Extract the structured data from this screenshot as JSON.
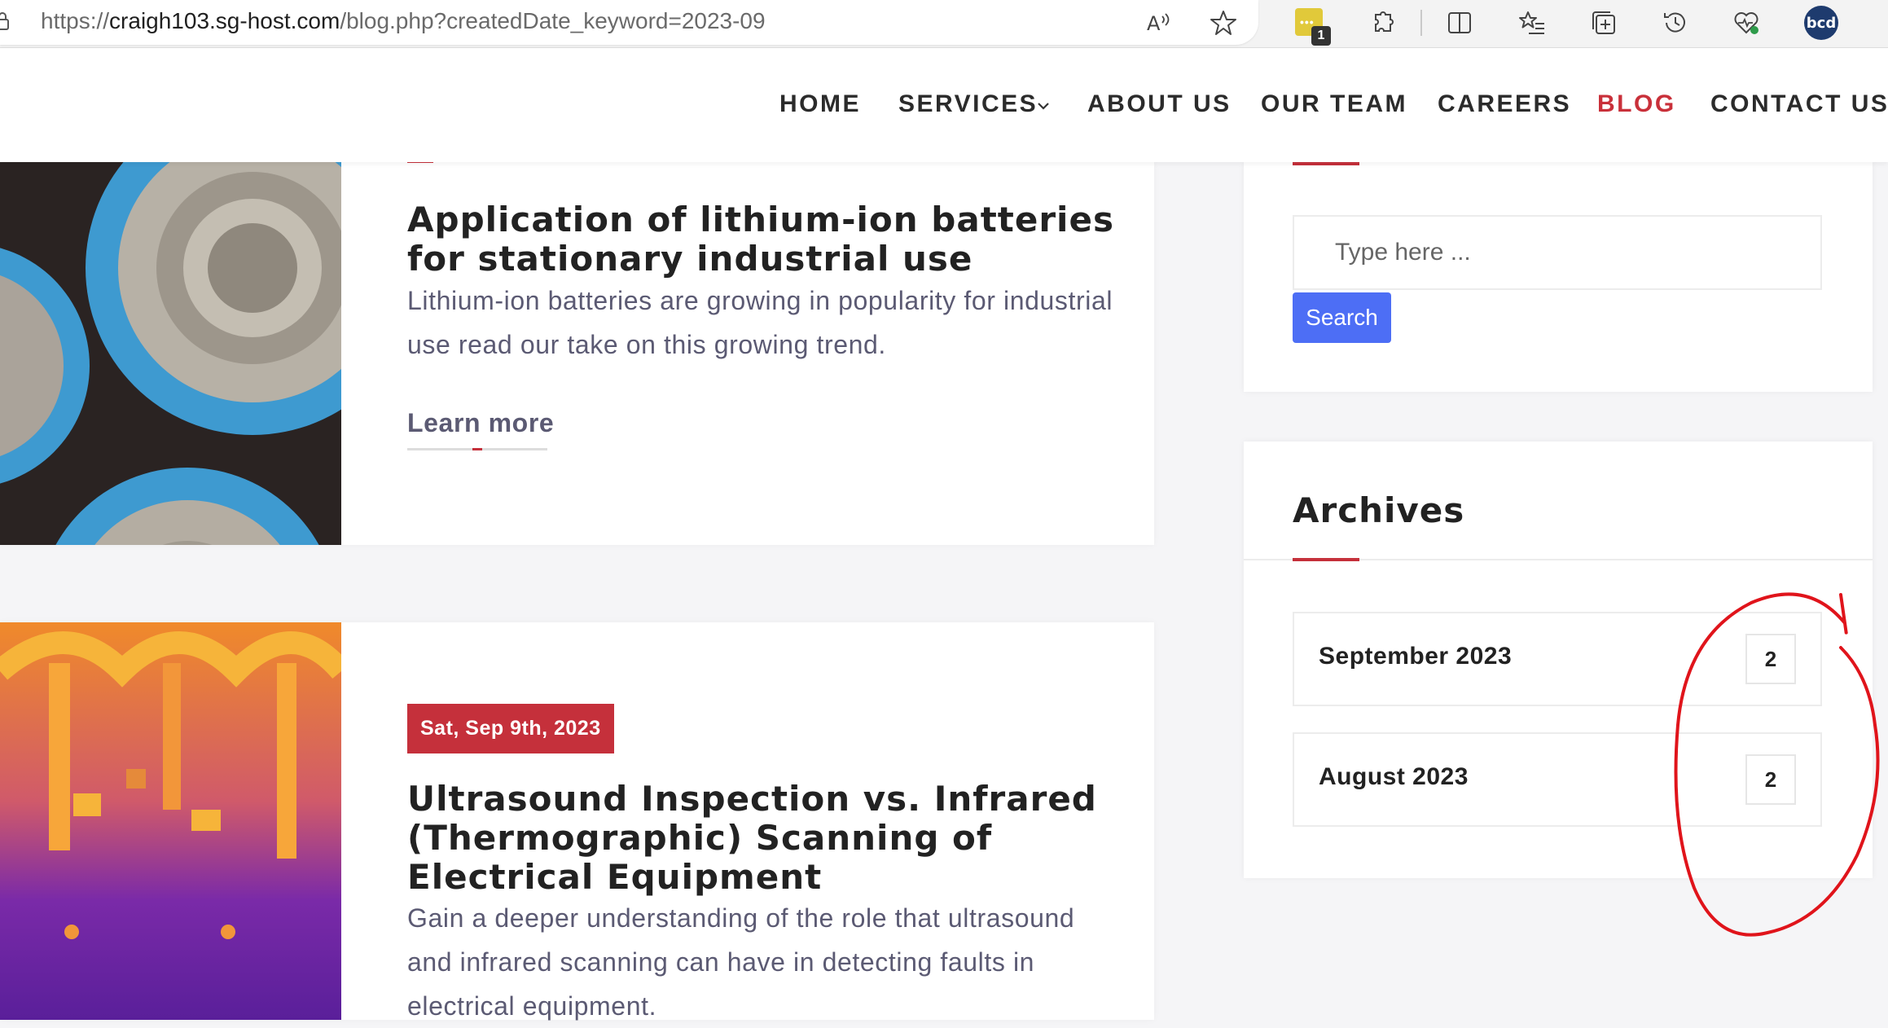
{
  "browser": {
    "url_prefix": "https://",
    "url_host": "craigh103.sg-host.com",
    "url_path": "/blog.php?createdDate_keyword=2023-09",
    "extension_badge_count": "1",
    "profile_initials": "bcd",
    "icons": [
      "read-aloud-icon",
      "favorite-star-icon",
      "extension-badge-icon",
      "extensions-puzzle-icon",
      "split-screen-icon",
      "favorites-list-icon",
      "collections-icon",
      "history-icon",
      "browser-health-icon",
      "profile-avatar"
    ]
  },
  "nav": {
    "items": [
      {
        "label": "HOME"
      },
      {
        "label": "SERVICES"
      },
      {
        "label": "ABOUT US"
      },
      {
        "label": "OUR TEAM"
      },
      {
        "label": "CAREERS"
      },
      {
        "label": "BLOG"
      },
      {
        "label": "CONTACT US"
      }
    ],
    "active": "BLOG",
    "accent_color": "#c9303a"
  },
  "posts": [
    {
      "title": "Application of lithium-ion batteries for stationary industrial use",
      "excerpt": "Lithium-ion batteries are growing in popularity for industrial use read our take on this growing trend.",
      "link_label": "Learn more"
    },
    {
      "date": "Sat, Sep 9th, 2023",
      "title": "Ultrasound Inspection vs. Infrared (Thermographic) Scanning of Electrical Equipment",
      "excerpt": "Gain a deeper understanding of the role that ultrasound and infrared scanning can have in detecting faults in electrical equipment."
    }
  ],
  "sidebar": {
    "search": {
      "placeholder": "Type here ...",
      "button_label": "Search",
      "button_color": "#4d6ef5"
    },
    "archives": {
      "title": "Archives",
      "items": [
        {
          "label": "September 2023",
          "count": "2"
        },
        {
          "label": "August 2023",
          "count": "2"
        }
      ]
    }
  },
  "annotation": {
    "color": "#e0141b",
    "shape": "hand-drawn circle around archive counts"
  }
}
